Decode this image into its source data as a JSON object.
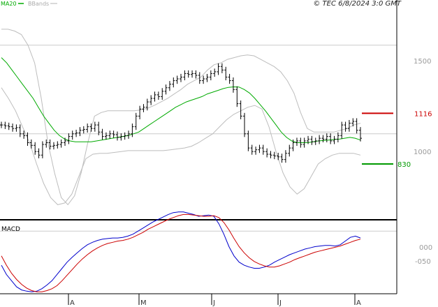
{
  "header": {
    "legend_ma": "MA20",
    "legend_bb": "BBands",
    "copyright": "© TEC 6/8/2024 3:0 GMT"
  },
  "price_axis_labels": [
    "1500",
    "1000"
  ],
  "levels": {
    "resistance": {
      "label": "1116",
      "value": 1116,
      "color": "#cc0000"
    },
    "support": {
      "label": "830",
      "value": 830,
      "color": "#009900"
    }
  },
  "macd": {
    "title": "MACD",
    "axis_labels": [
      "000",
      "-050"
    ]
  },
  "x_axis": {
    "months": [
      "A",
      "M",
      "J",
      "J",
      "A"
    ]
  },
  "colors": {
    "ma": "#00aa00",
    "bbands": "#bdbdbd",
    "bars": "#000000",
    "macd_line": "#0000cc",
    "signal_line": "#cc0000",
    "grid": "#cccccc"
  },
  "chart_data": [
    {
      "type": "line",
      "title": "",
      "price_ylim": [
        515,
        1755
      ],
      "series": [
        {
          "name": "",
          "values": [
            1050,
            1045,
            1040,
            1030,
            1035,
            1000,
            990,
            950,
            935,
            900,
            880,
            940,
            950,
            930,
            935,
            940,
            950,
            960,
            985,
            1000,
            1005,
            1020,
            1025,
            1040,
            1030,
            1050,
            1010,
            985,
            990,
            1000,
            995,
            980,
            985,
            990,
            1000,
            1040,
            1100,
            1140,
            1150,
            1180,
            1200,
            1220,
            1210,
            1240,
            1260,
            1280,
            1300,
            1310,
            1320,
            1340,
            1335,
            1340,
            1330,
            1300,
            1310,
            1320,
            1340,
            1350,
            1380,
            1360,
            1320,
            1300,
            1250,
            1170,
            1100,
            1000,
            920,
            900,
            910,
            920,
            900,
            885,
            880,
            875,
            870,
            855,
            890,
            920,
            950,
            960,
            940,
            960,
            970,
            955,
            960,
            975,
            970,
            985,
            960,
            970,
            990,
            1050,
            1030,
            1060,
            1070,
            1020,
            975
          ]
        },
        {
          "name": "MA20",
          "values": [
            1430,
            1400,
            1360,
            1320,
            1280,
            1240,
            1200,
            1150,
            1100,
            1060,
            1020,
            990,
            970,
            960,
            955,
            955,
            955,
            955,
            960,
            965,
            970,
            975,
            980,
            985,
            990,
            1000,
            1010,
            1030,
            1050,
            1070,
            1090,
            1110,
            1130,
            1150,
            1165,
            1180,
            1190,
            1200,
            1210,
            1225,
            1235,
            1245,
            1255,
            1262,
            1265,
            1264,
            1250,
            1230,
            1200,
            1165,
            1130,
            1090,
            1050,
            1010,
            980,
            960,
            950,
            950,
            950,
            955,
            960,
            962,
            965,
            968,
            970,
            975,
            980,
            975,
            965
          ]
        }
      ],
      "bbands": [
        {
          "name": "",
          "values": [
            1590,
            1590,
            1580,
            1560,
            1500,
            1400,
            1200,
            950,
            780,
            640,
            600,
            650,
            780,
            950,
            1100,
            1120,
            1130,
            1130,
            1130,
            1130,
            1130,
            1135,
            1145,
            1160,
            1180,
            1200,
            1225,
            1250,
            1280,
            1300,
            1320,
            1360,
            1390,
            1400,
            1420,
            1430,
            1440,
            1445,
            1440,
            1420,
            1400,
            1380,
            1350,
            1300,
            1230,
            1120,
            1030,
            1010,
            1010,
            1010,
            1010,
            1020,
            1030,
            1050,
            1060
          ]
        },
        {
          "name": "",
          "values": [
            1260,
            1200,
            1130,
            1040,
            950,
            830,
            720,
            640,
            600,
            610,
            660,
            760,
            860,
            885,
            890,
            890,
            895,
            900,
            905,
            905,
            905,
            905,
            905,
            905,
            910,
            915,
            920,
            930,
            950,
            975,
            1000,
            1040,
            1080,
            1110,
            1130,
            1150,
            1160,
            1140,
            1040,
            900,
            780,
            700,
            660,
            690,
            760,
            830,
            860,
            880,
            890,
            890,
            890,
            880
          ]
        }
      ],
      "xaxis_months": [
        "A",
        "M",
        "J",
        "J",
        "A"
      ]
    },
    {
      "type": "line",
      "title": "MACD",
      "ylim": [
        -100,
        15
      ],
      "series": [
        {
          "name": "",
          "values": [
            -55,
            -70,
            -80,
            -90,
            -95,
            -97,
            -98,
            -97,
            -93,
            -87,
            -80,
            -70,
            -60,
            -50,
            -42,
            -35,
            -28,
            -22,
            -18,
            -15,
            -13,
            -12,
            -11,
            -11,
            -10,
            -8,
            -5,
            0,
            5,
            10,
            15,
            19,
            23,
            27,
            30,
            31,
            31,
            29,
            27,
            24,
            25,
            26,
            24,
            12,
            -5,
            -25,
            -40,
            -50,
            -55,
            -58,
            -60,
            -60,
            -58,
            -55,
            -50,
            -46,
            -42,
            -38,
            -35,
            -32,
            -29,
            -27,
            -25,
            -24,
            -23,
            -23,
            -24,
            -22,
            -16,
            -10,
            -8,
            -11
          ]
        },
        {
          "name": "",
          "values": [
            -40,
            -55,
            -68,
            -78,
            -86,
            -92,
            -96,
            -98,
            -98,
            -96,
            -93,
            -88,
            -80,
            -71,
            -62,
            -53,
            -45,
            -38,
            -32,
            -27,
            -23,
            -20,
            -18,
            -16,
            -15,
            -13,
            -10,
            -6,
            -2,
            3,
            7,
            11,
            15,
            19,
            22,
            25,
            27,
            27,
            26,
            25,
            24,
            24,
            25,
            22,
            14,
            2,
            -12,
            -25,
            -35,
            -43,
            -49,
            -53,
            -56,
            -58,
            -58,
            -56,
            -53,
            -50,
            -46,
            -43,
            -40,
            -37,
            -34,
            -32,
            -30,
            -28,
            -26,
            -24,
            -21,
            -18,
            -15,
            -13
          ]
        }
      ]
    }
  ]
}
